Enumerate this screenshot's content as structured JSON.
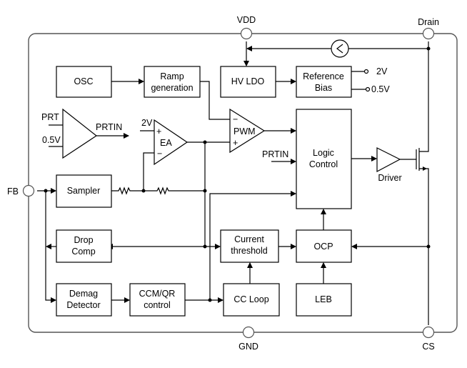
{
  "pins": {
    "vdd": "VDD",
    "drain": "Drain",
    "fb": "FB",
    "gnd": "GND",
    "cs": "CS"
  },
  "blocks": {
    "osc": [
      "OSC"
    ],
    "ramp": [
      "Ramp",
      "generation"
    ],
    "hvldo": [
      "HV LDO"
    ],
    "refbias": [
      "Reference",
      "Bias"
    ],
    "logic": [
      "Logic",
      "Control"
    ],
    "sampler": [
      "Sampler"
    ],
    "dropcomp": [
      "Drop",
      "Comp"
    ],
    "current_threshold": [
      "Current",
      "threshold"
    ],
    "ocp": [
      "OCP"
    ],
    "demag": [
      "Demag",
      "Detector"
    ],
    "ccmqr": [
      "CCM/QR",
      "control"
    ],
    "ccloop": [
      "CC Loop"
    ],
    "leb": [
      "LEB"
    ]
  },
  "amplifiers": {
    "prt_comp": {
      "in_pos": "PRT",
      "in_neg": "0.5V",
      "out": "PRTIN"
    },
    "ea": {
      "label": "EA",
      "ref": "2V",
      "plus": "+",
      "minus": "−"
    },
    "pwm": {
      "label": "PWM",
      "plus": "+",
      "minus": "−"
    },
    "driver": {
      "label": "Driver"
    }
  },
  "signals": {
    "ref_2v": "2V",
    "ref_05v": "0.5V",
    "logic_prtin": "PRTIN"
  }
}
